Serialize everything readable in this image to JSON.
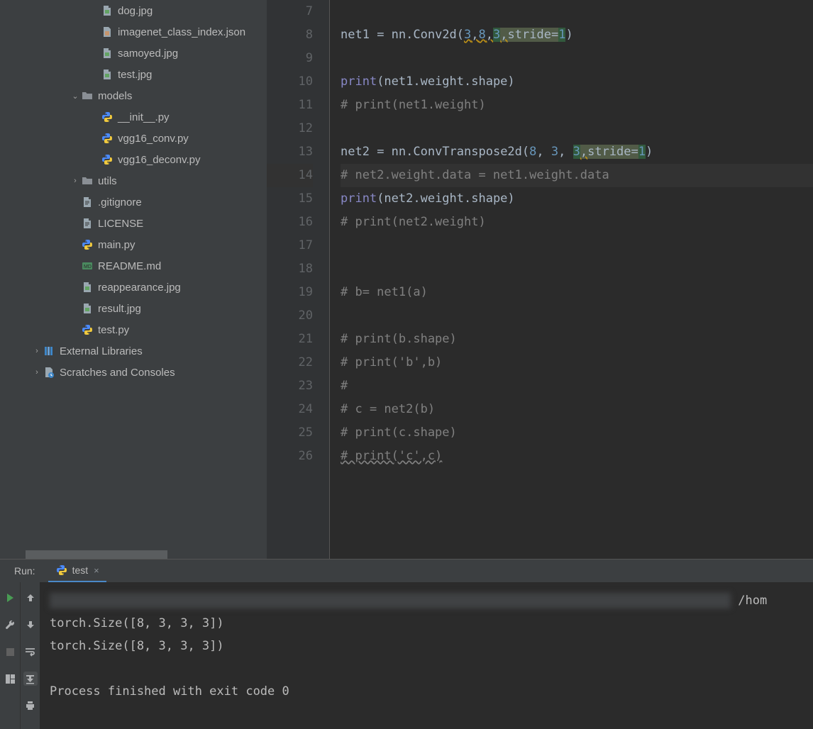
{
  "sidebar": {
    "items": [
      {
        "type": "file",
        "depth": 3,
        "icon": "jpg",
        "label": "dog.jpg"
      },
      {
        "type": "file",
        "depth": 3,
        "icon": "json",
        "label": "imagenet_class_index.json"
      },
      {
        "type": "file",
        "depth": 3,
        "icon": "jpg",
        "label": "samoyed.jpg"
      },
      {
        "type": "file",
        "depth": 3,
        "icon": "jpg",
        "label": "test.jpg"
      },
      {
        "type": "folder",
        "depth": 2,
        "expanded": true,
        "label": "models"
      },
      {
        "type": "file",
        "depth": 3,
        "icon": "py",
        "label": "__init__.py"
      },
      {
        "type": "file",
        "depth": 3,
        "icon": "py",
        "label": "vgg16_conv.py"
      },
      {
        "type": "file",
        "depth": 3,
        "icon": "py",
        "label": "vgg16_deconv.py"
      },
      {
        "type": "folder",
        "depth": 2,
        "expanded": false,
        "label": "utils"
      },
      {
        "type": "file",
        "depth": 2,
        "icon": "txt",
        "label": ".gitignore"
      },
      {
        "type": "file",
        "depth": 2,
        "icon": "txt",
        "label": "LICENSE"
      },
      {
        "type": "file",
        "depth": 2,
        "icon": "py",
        "label": "main.py"
      },
      {
        "type": "file",
        "depth": 2,
        "icon": "md",
        "label": "README.md"
      },
      {
        "type": "file",
        "depth": 2,
        "icon": "jpg",
        "label": "reappearance.jpg"
      },
      {
        "type": "file",
        "depth": 2,
        "icon": "jpg",
        "label": "result.jpg"
      },
      {
        "type": "file",
        "depth": 2,
        "icon": "py",
        "label": "test.py"
      },
      {
        "type": "lib",
        "depth": 0,
        "expanded": false,
        "icon": "lib",
        "label": "External Libraries"
      },
      {
        "type": "scratch",
        "depth": 0,
        "expanded": false,
        "icon": "scratch",
        "label": "Scratches and Consoles"
      }
    ]
  },
  "editor": {
    "first_line": 7,
    "active_line": 14,
    "lines": [
      {
        "n": 7,
        "html": ""
      },
      {
        "n": 8,
        "html": "<span class='def'>net1 </span><span class='ident'>=</span> nn.Conv2d(<span class='num warn'>3</span><span class='warn'>,</span><span class='num warn'>8</span><span class='warn'>,</span><span class='hl-num'>3</span><span class='hl warn'>,</span><span class='hl'>stride</span><span class='hl'>=</span><span class='hl-num'>1</span>)"
      },
      {
        "n": 9,
        "html": ""
      },
      {
        "n": 10,
        "html": "<span class='fn'>print</span>(net1.weight.shape)"
      },
      {
        "n": 11,
        "html": "<span class='cmt'># print(net1.weight)</span>"
      },
      {
        "n": 12,
        "html": ""
      },
      {
        "n": 13,
        "html": "<span class='def'>net2 </span><span class='ident'>=</span> nn.ConvTranspose2d(<span class='num'>8</span>, <span class='num'>3</span>, <span class='hl-num'>3</span><span class='warn hl'>,</span><span class='hl'>stride</span><span class='hl'>=</span><span class='hl-num'>1</span>)"
      },
      {
        "n": 14,
        "html": "<span class='cmt'># net2.weight.data = net1.weight.data</span>"
      },
      {
        "n": 15,
        "html": "<span class='fn'>print</span>(net2.weight.shape)"
      },
      {
        "n": 16,
        "html": "<span class='cmt'># print(net2.weight)</span>"
      },
      {
        "n": 17,
        "html": ""
      },
      {
        "n": 18,
        "html": ""
      },
      {
        "n": 19,
        "html": "<span class='cmt'># b= net1(a)</span>"
      },
      {
        "n": 20,
        "html": ""
      },
      {
        "n": 21,
        "html": "<span class='cmt'># print(b.shape)</span>"
      },
      {
        "n": 22,
        "html": "<span class='cmt'># print('b',b)</span>"
      },
      {
        "n": 23,
        "html": "<span class='cmt'>#</span>"
      },
      {
        "n": 24,
        "html": "<span class='cmt'># c = net2(b)</span>"
      },
      {
        "n": 25,
        "html": "<span class='cmt'># print(c.shape)</span>"
      },
      {
        "n": 26,
        "html": "<span class='cmt derr'># print('c',c)</span>"
      }
    ]
  },
  "run": {
    "label": "Run:",
    "tab": "test",
    "path_tail": "/hom",
    "output": [
      "torch.Size([8, 3, 3, 3])",
      "torch.Size([8, 3, 3, 3])",
      "",
      "Process finished with exit code 0"
    ]
  }
}
